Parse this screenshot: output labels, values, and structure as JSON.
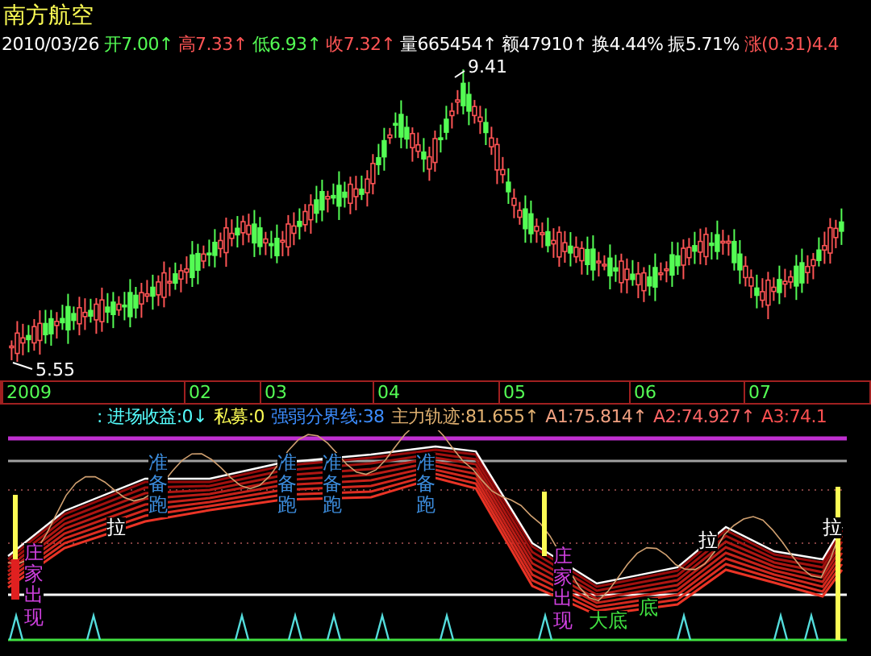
{
  "stock": {
    "name": "南方航空",
    "date": "2010/03/26"
  },
  "quote": [
    {
      "label": "开",
      "value": "7.00",
      "arrow": "↑",
      "color": "#54fc54"
    },
    {
      "label": "高",
      "value": "7.33",
      "arrow": "↑",
      "color": "#fc5454"
    },
    {
      "label": "低",
      "value": "6.93",
      "arrow": "↑",
      "color": "#54fc54"
    },
    {
      "label": "收",
      "value": "7.32",
      "arrow": "↑",
      "color": "#fc5454"
    },
    {
      "label": "量",
      "value": "665454",
      "arrow": "↑",
      "color": "#ffffff"
    },
    {
      "label": "额",
      "value": "47910",
      "arrow": "↑",
      "color": "#ffffff"
    },
    {
      "label": "换",
      "value": "4.44%",
      "color": "#ffffff"
    },
    {
      "label": "振",
      "value": "5.71%",
      "color": "#ffffff"
    },
    {
      "label": "涨",
      "value": "(0.31)4.4",
      "color": "#fc5454"
    }
  ],
  "price_chart": {
    "high_label": "9.41",
    "low_label": "5.55"
  },
  "time_axis": [
    "2009",
    "02",
    "03",
    "04",
    "05",
    "06",
    "07"
  ],
  "indicator_line": [
    {
      "text": ": 进场收益:0",
      "arrow": "↓",
      "color": "#54fcfc"
    },
    {
      "text": "私募:0",
      "color": "#fcfc54"
    },
    {
      "text": "强弱分界线:38",
      "color": "#3c8cfc"
    },
    {
      "text": "主力轨迹:81.655",
      "arrow": "↑",
      "color": "#e0b070"
    },
    {
      "text": "A1:75.814",
      "arrow": "↑",
      "color": "#f0a080"
    },
    {
      "text": "A2:74.927",
      "arrow": "↑",
      "color": "#fc6464"
    },
    {
      "text": "A3:74.1",
      "color": "#fc5050"
    }
  ],
  "signals": [
    {
      "text": "准备跑",
      "kind": "run"
    },
    {
      "text": "准备跑",
      "kind": "run"
    },
    {
      "text": "准备跑",
      "kind": "run"
    },
    {
      "text": "准备跑",
      "kind": "run"
    },
    {
      "text": "拉",
      "kind": "pull"
    },
    {
      "text": "拉",
      "kind": "pull"
    },
    {
      "text": "拉",
      "kind": "pull"
    },
    {
      "text": "庄家出现",
      "kind": "dealer"
    },
    {
      "text": "庄家出现",
      "kind": "dealer"
    },
    {
      "text": "底",
      "kind": "bottom"
    },
    {
      "text": "大底",
      "kind": "bottom"
    }
  ]
}
